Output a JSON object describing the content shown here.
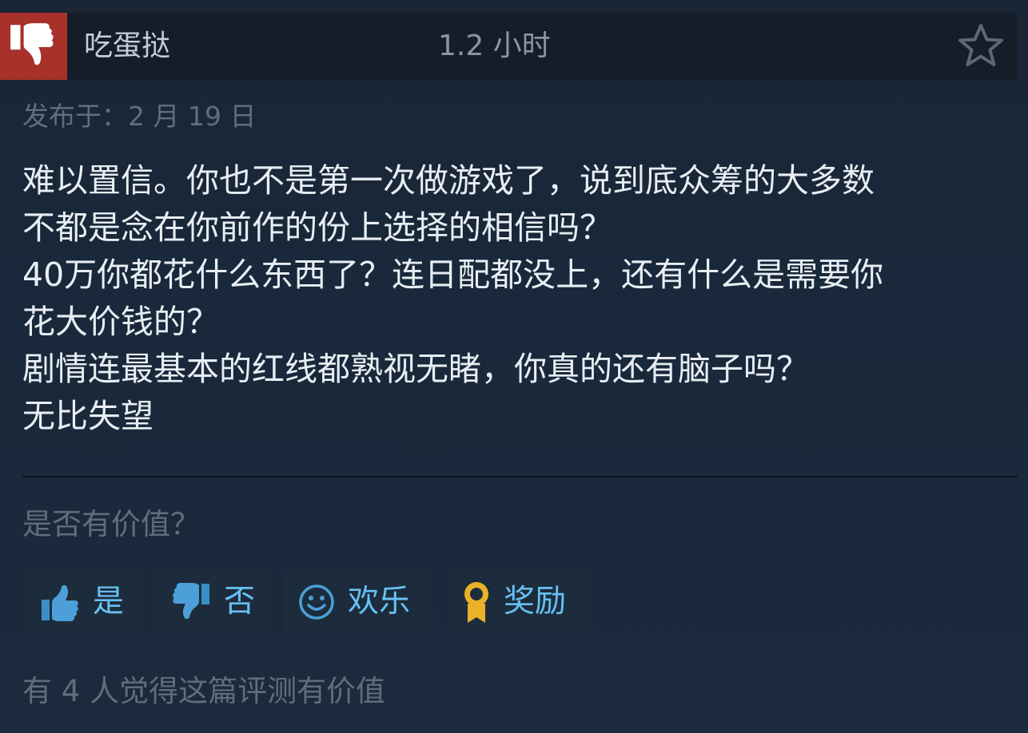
{
  "review": {
    "rating_icon": "thumbs-down-icon",
    "author": "吃蛋挞",
    "hours": "1.2 小时",
    "posted": "发布于：2 月 19 日",
    "body_lines": [
      "难以置信。你也不是第一次做游戏了，说到底众筹的大多数",
      "不都是念在你前作的份上选择的相信吗？",
      "40万你都花什么东西了？连日配都没上，还有什么是需要你",
      "花大价钱的？",
      "剧情连最基本的红线都熟视无睹，你真的还有脑子吗？",
      "无比失望"
    ]
  },
  "feedback": {
    "question": "是否有价值？",
    "buttons": {
      "yes": {
        "label": "是",
        "icon": "thumbs-up-icon"
      },
      "no": {
        "label": "否",
        "icon": "thumbs-down-icon"
      },
      "funny": {
        "label": "欢乐",
        "icon": "smiley-icon"
      },
      "award": {
        "label": "奖励",
        "icon": "award-ribbon-icon"
      }
    },
    "helpful_text": "有 4 人觉得这篇评测有价值"
  },
  "colors": {
    "background": "#1b2838",
    "header": "#141d28",
    "negative_badge": "#a8312b",
    "link_blue": "#67c1f5",
    "award_gold": "#e9b228"
  }
}
